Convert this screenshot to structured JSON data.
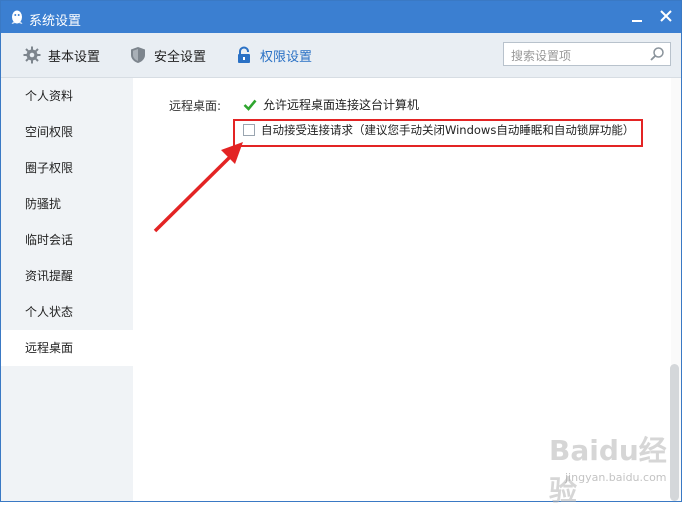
{
  "window": {
    "title": "系统设置",
    "accent": "#3b7fd1"
  },
  "tabs": [
    {
      "label": "基本设置",
      "icon": "gear-icon",
      "active": false
    },
    {
      "label": "安全设置",
      "icon": "shield-icon",
      "active": false
    },
    {
      "label": "权限设置",
      "icon": "lock-icon",
      "active": true
    }
  ],
  "search": {
    "placeholder": "搜索设置项"
  },
  "sidebar": {
    "items": [
      {
        "label": "个人资料"
      },
      {
        "label": "空间权限"
      },
      {
        "label": "圈子权限"
      },
      {
        "label": "防骚扰"
      },
      {
        "label": "临时会话"
      },
      {
        "label": "资讯提醒"
      },
      {
        "label": "个人状态"
      },
      {
        "label": "远程桌面",
        "active": true
      }
    ]
  },
  "remote_desktop": {
    "section_label": "远程桌面:",
    "option_allow": {
      "label": "允许远程桌面连接这台计算机",
      "checked": true
    },
    "option_auto_accept": {
      "label": "自动接受连接请求（建议您手动关闭Windows自动睡眠和自动锁屏功能）",
      "checked": false
    }
  },
  "annotation": {
    "highlight_color": "#e32424"
  },
  "watermark": {
    "text": "Baidu经验",
    "sub": "jingyan.baidu.com"
  }
}
